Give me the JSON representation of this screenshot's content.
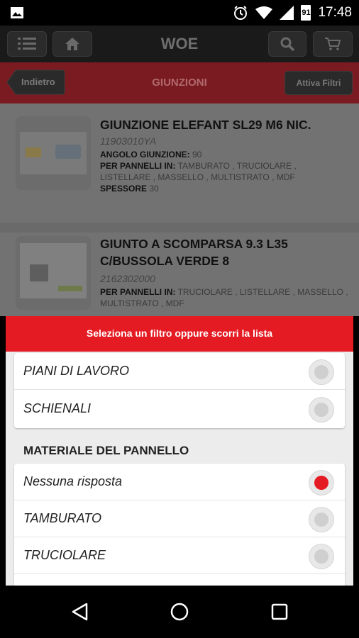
{
  "status_bar": {
    "time": "17:48",
    "battery_level": "91"
  },
  "app_bar": {
    "title": "WOE",
    "icons": [
      "menu-icon",
      "home-icon",
      "search-icon",
      "cart-icon"
    ]
  },
  "sub_bar": {
    "back_label": "Indietro",
    "title": "GIUNZIONI",
    "filter_label": "Attiva Filtri"
  },
  "products": [
    {
      "name": "GIUNZIONE ELEFANT SL29 M6 NIC.",
      "code": "11903010YA",
      "attrs": [
        {
          "key": "ANGOLO GIUNZIONE:",
          "value": " 90"
        },
        {
          "key": "PER PANNELLI IN:",
          "value": " TAMBURATO , TRUCIOLARE , LISTELLARE , MASSELLO , MULTISTRATO , MDF"
        },
        {
          "key": "SPESSORE",
          "value": " 30"
        }
      ]
    },
    {
      "name": "GIUNTO A SCOMPARSA 9.3 L35 C/BUSSOLA VERDE 8",
      "code": "2162302000",
      "attrs": [
        {
          "key": "PER PANNELLI IN:",
          "value": " TRUCIOLARE , LISTELLARE , MASSELLO , MULTISTRATO , MDF"
        }
      ]
    }
  ],
  "filter_sheet": {
    "header": "Seleziona un filtro oppure scorri la lista",
    "group1_options": [
      {
        "label": "PIANI DI LAVORO",
        "selected": false
      },
      {
        "label": "SCHIENALI",
        "selected": false
      }
    ],
    "section_title": "MATERIALE DEL PANNELLO",
    "group2_options": [
      {
        "label": "Nessuna risposta",
        "selected": true
      },
      {
        "label": "TAMBURATO",
        "selected": false
      },
      {
        "label": "TRUCIOLARE",
        "selected": false
      }
    ]
  },
  "colors": {
    "accent": "#e41b23",
    "header_dimmed": "#7a1b21"
  }
}
